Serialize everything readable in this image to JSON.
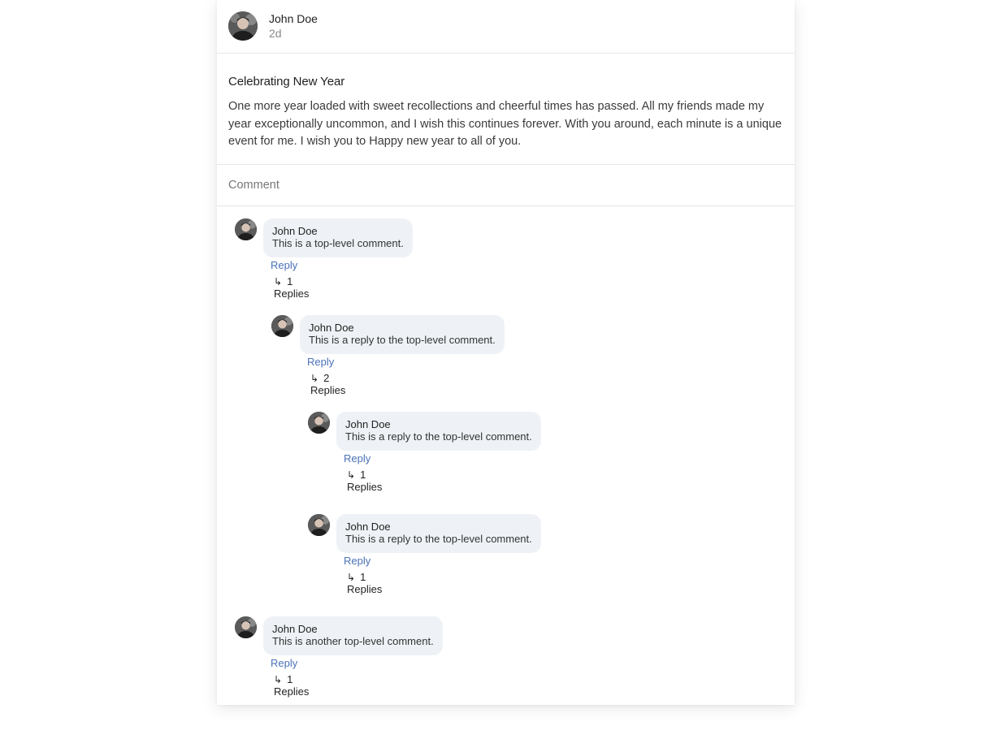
{
  "post": {
    "author": "John Doe",
    "time": "2d",
    "title": "Celebrating New Year",
    "text": "One more year loaded with sweet recollections and cheerful times has passed. All my friends made my year exceptionally uncommon, and I wish this continues forever. With you around, each minute is a unique event for me. I wish you to Happy new year to all of you."
  },
  "comment_input": {
    "placeholder": "Comment"
  },
  "comments": [
    {
      "author": "John Doe",
      "text": "This is a top-level comment.",
      "reply_label": "Reply",
      "replies_label": "1 Replies"
    },
    {
      "author": "John Doe",
      "text": "This is a reply to the top-level comment.",
      "reply_label": "Reply",
      "replies_label": "2 Replies"
    },
    {
      "author": "John Doe",
      "text": "This is a reply to the top-level comment.",
      "reply_label": "Reply",
      "replies_label": "1 Replies"
    },
    {
      "author": "John Doe",
      "text": "This is a reply to the top-level comment.",
      "reply_label": "Reply",
      "replies_label": "1 Replies"
    },
    {
      "author": "John Doe",
      "text": "This is another top-level comment.",
      "reply_label": "Reply",
      "replies_label": "1 Replies"
    }
  ],
  "icons": {
    "reply_arrow": "↳"
  }
}
